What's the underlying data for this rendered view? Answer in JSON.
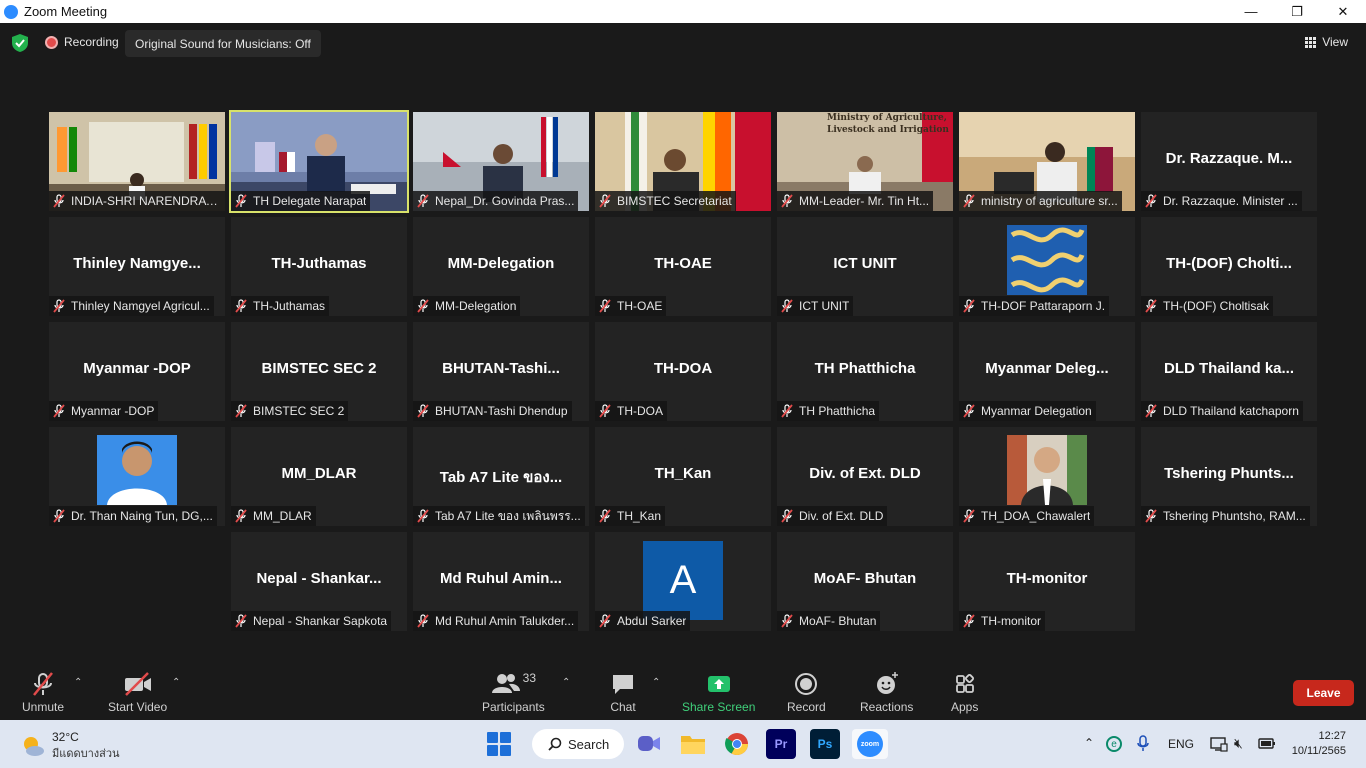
{
  "window": {
    "title": "Zoom Meeting",
    "minimize": "—",
    "maximize": "❐",
    "close": "✕"
  },
  "meeting_top": {
    "recording_label": "Recording",
    "original_sound_label": "Original Sound for Musicians: Off",
    "view_label": "View"
  },
  "tiles": [
    {
      "label": "INDIA-SHRI NARENDRA SI...",
      "kind": "video",
      "scene": "india"
    },
    {
      "label": "TH Delegate Narapat",
      "kind": "video",
      "scene": "thai",
      "active": true
    },
    {
      "label": "Nepal_Dr. Govinda Pras...",
      "kind": "video",
      "scene": "nepal"
    },
    {
      "label": "BIMSTEC Secretariat",
      "kind": "video",
      "scene": "bimstec"
    },
    {
      "label": "MM-Leader- Mr. Tin Ht...",
      "kind": "video",
      "scene": "myanmar",
      "banner_line1": "Ministry of Agriculture,",
      "banner_line2": "Livestock and Irrigation"
    },
    {
      "label": "ministry of agriculture sr...",
      "kind": "video",
      "scene": "srilanka"
    },
    {
      "label": "Dr. Razzaque. Minister ...",
      "kind": "name",
      "display": "Dr. Razzaque. M..."
    },
    {
      "label": "Thinley Namgyel Agricul...",
      "kind": "name",
      "display": "Thinley  Namgye..."
    },
    {
      "label": "TH-Juthamas",
      "kind": "name",
      "display": "TH-Juthamas"
    },
    {
      "label": "MM-Delegation",
      "kind": "name",
      "display": "MM-Delegation"
    },
    {
      "label": "TH-OAE",
      "kind": "name",
      "display": "TH-OAE"
    },
    {
      "label": "ICT UNIT",
      "kind": "name",
      "display": "ICT UNIT"
    },
    {
      "label": "TH-DOF Pattaraporn J.",
      "kind": "avatar",
      "avatar": "pattern"
    },
    {
      "label": "TH-(DOF) Choltisak",
      "kind": "name",
      "display": "TH-(DOF)  Cholti..."
    },
    {
      "label": "Myanmar -DOP",
      "kind": "name",
      "display": "Myanmar -DOP"
    },
    {
      "label": "BIMSTEC SEC 2",
      "kind": "name",
      "display": "BIMSTEC SEC 2"
    },
    {
      "label": "BHUTAN-Tashi Dhendup",
      "kind": "name",
      "display": "BHUTAN-Tashi..."
    },
    {
      "label": "TH-DOA",
      "kind": "name",
      "display": "TH-DOA"
    },
    {
      "label": "TH Phatthicha",
      "kind": "name",
      "display": "TH Phatthicha"
    },
    {
      "label": "Myanmar Delegation",
      "kind": "name",
      "display": "Myanmar  Deleg..."
    },
    {
      "label": "DLD Thailand katchaporn",
      "kind": "name",
      "display": "DLD  Thailand  ka..."
    },
    {
      "label": "Dr. Than Naing Tun, DG,...",
      "kind": "avatar",
      "avatar": "portrait-blue"
    },
    {
      "label": "MM_DLAR",
      "kind": "name",
      "display": "MM_DLAR"
    },
    {
      "label": "Tab A7 Lite ของ เพลินพรร...",
      "kind": "name",
      "display": "Tab A7 Lite ของ..."
    },
    {
      "label": "TH_Kan",
      "kind": "name",
      "display": "TH_Kan"
    },
    {
      "label": "Div. of  Ext. DLD",
      "kind": "name",
      "display": "Div. of  Ext. DLD"
    },
    {
      "label": "TH_DOA_Chawalert",
      "kind": "avatar",
      "avatar": "portrait-suit"
    },
    {
      "label": "Tshering Phuntsho, RAM...",
      "kind": "name",
      "display": "Tshering  Phunts..."
    },
    {
      "label": "Nepal - Shankar Sapkota",
      "kind": "name",
      "display": "Nepal  -  Shankar..."
    },
    {
      "label": "Md Ruhul Amin Talukder...",
      "kind": "name",
      "display": "Md  Ruhul  Amin..."
    },
    {
      "label": "Abdul Sarker",
      "kind": "letter",
      "letter": "A"
    },
    {
      "label": "MoAF- Bhutan",
      "kind": "name",
      "display": "MoAF-  Bhutan"
    },
    {
      "label": "TH-monitor",
      "kind": "name",
      "display": "TH-monitor"
    }
  ],
  "toolbar": {
    "unmute": "Unmute",
    "start_video": "Start Video",
    "participants": "Participants",
    "participants_count": "33",
    "chat": "Chat",
    "share_screen": "Share Screen",
    "record": "Record",
    "reactions": "Reactions",
    "apps": "Apps",
    "leave": "Leave"
  },
  "taskbar": {
    "temperature": "32°C",
    "weather_condition": "มีแดดบางส่วน",
    "search_label": "Search",
    "apps": [
      "meet-icon",
      "file-explorer-icon",
      "chrome-icon",
      "premiere-icon",
      "photoshop-icon",
      "zoom-icon"
    ],
    "premiere_label": "Pr",
    "photoshop_label": "Ps",
    "zoom_label": "zoom",
    "language": "ENG",
    "time": "12:27",
    "date": "10/11/2565"
  },
  "colors": {
    "leave": "#c7281c",
    "share_green": "#3fd07a",
    "active_speaker": "#d8e26a",
    "letter_avatar": "#0e5aa7"
  }
}
